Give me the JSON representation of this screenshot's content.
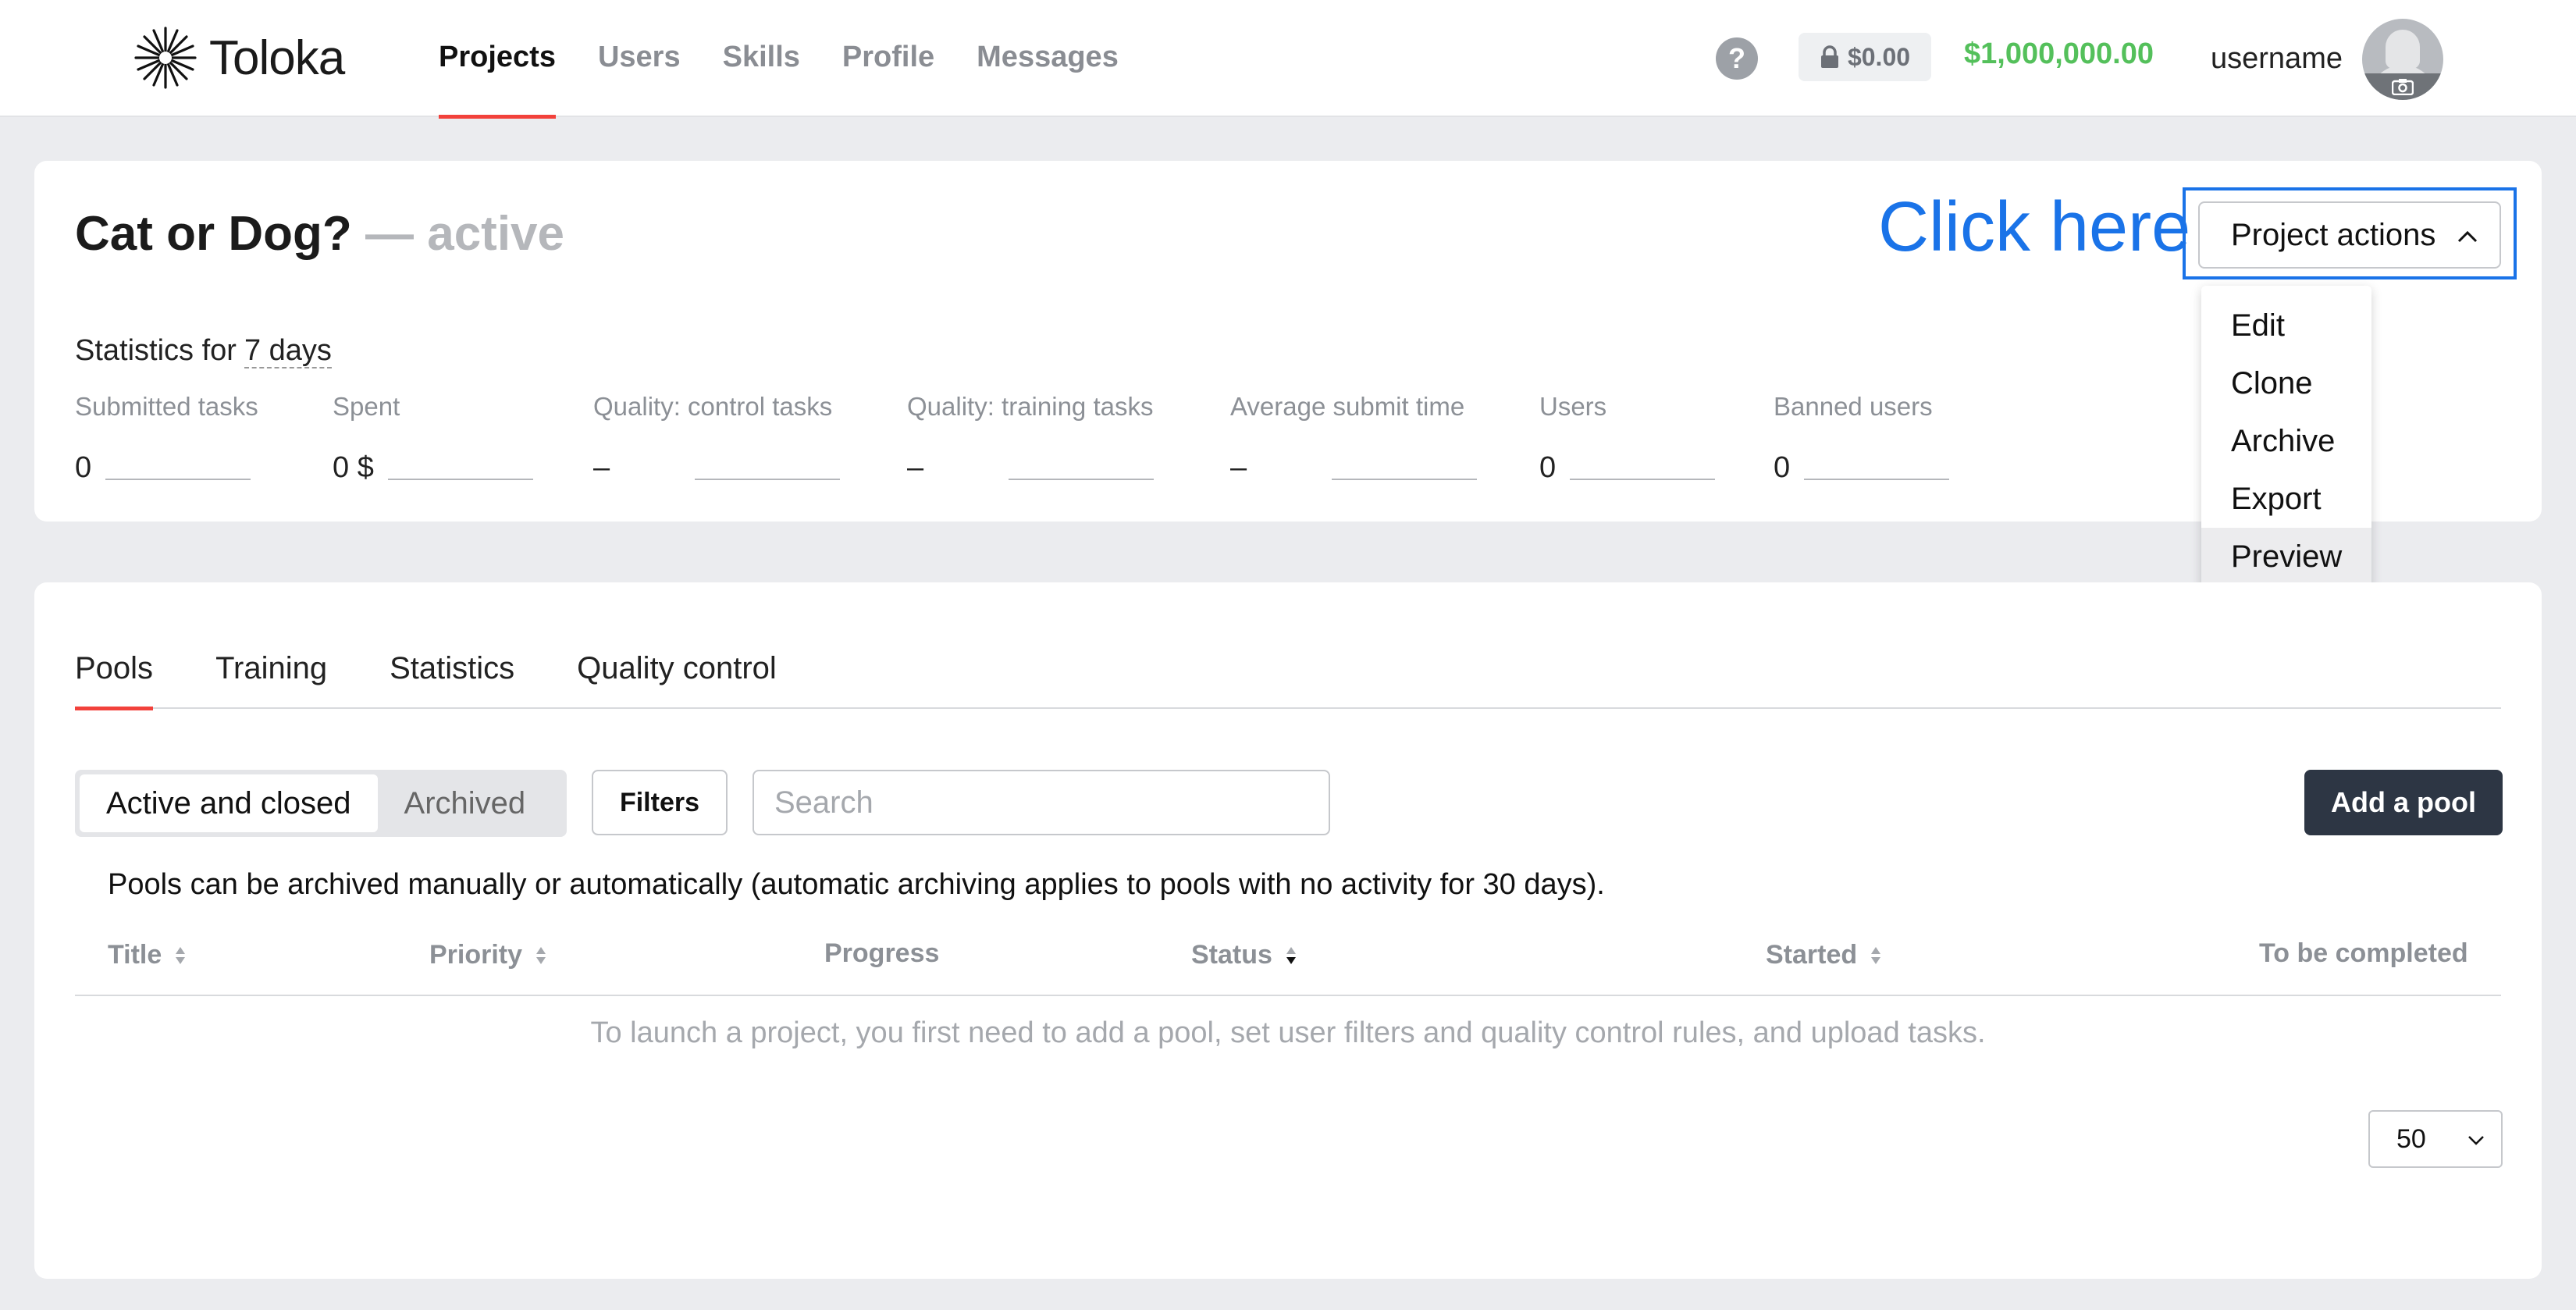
{
  "header": {
    "logo_text": "Toloka",
    "nav": [
      {
        "label": "Projects",
        "active": true
      },
      {
        "label": "Users",
        "active": false
      },
      {
        "label": "Skills",
        "active": false
      },
      {
        "label": "Profile",
        "active": false
      },
      {
        "label": "Messages",
        "active": false
      }
    ],
    "help_icon": "?",
    "locked_balance": "$0.00",
    "balance": "$1,000,000.00",
    "username": "username"
  },
  "project": {
    "title": "Cat or Dog?",
    "status": "— active",
    "annotation": "Click here",
    "actions_label": "Project actions",
    "actions_menu": [
      "Edit",
      "Clone",
      "Archive",
      "Export",
      "Preview"
    ],
    "hovered_item": "Preview",
    "stats_prefix": "Statistics for",
    "stats_period": "7 days",
    "stats": [
      {
        "label": "Submitted tasks",
        "value": "0"
      },
      {
        "label": "Spent",
        "value": "0 $"
      },
      {
        "label": "Quality: control tasks",
        "value": "–"
      },
      {
        "label": "Quality: training tasks",
        "value": "–"
      },
      {
        "label": "Average submit time",
        "value": "–"
      },
      {
        "label": "Users",
        "value": "0"
      },
      {
        "label": "Banned users",
        "value": "0"
      }
    ]
  },
  "pools": {
    "tabs": [
      {
        "label": "Pools",
        "active": true
      },
      {
        "label": "Training",
        "active": false
      },
      {
        "label": "Statistics",
        "active": false
      },
      {
        "label": "Quality control",
        "active": false
      }
    ],
    "segment": {
      "active": "Active and closed",
      "archived": "Archived"
    },
    "filters_label": "Filters",
    "search_placeholder": "Search",
    "add_pool_label": "Add a pool",
    "archive_note": "Pools can be archived manually or automatically (automatic archiving applies to pools with no activity for 30 days).",
    "columns": {
      "title": "Title",
      "priority": "Priority",
      "progress": "Progress",
      "status": "Status",
      "started": "Started",
      "to_be_completed": "To be completed"
    },
    "empty_message": "To launch a project, you first need to add a pool, set user filters and quality control rules, and upload tasks.",
    "page_size": "50"
  },
  "colors": {
    "accent_red": "#f2413b",
    "balance_green": "#54c05b",
    "annotation_blue": "#1a73e8",
    "primary_button": "#2d3644"
  }
}
